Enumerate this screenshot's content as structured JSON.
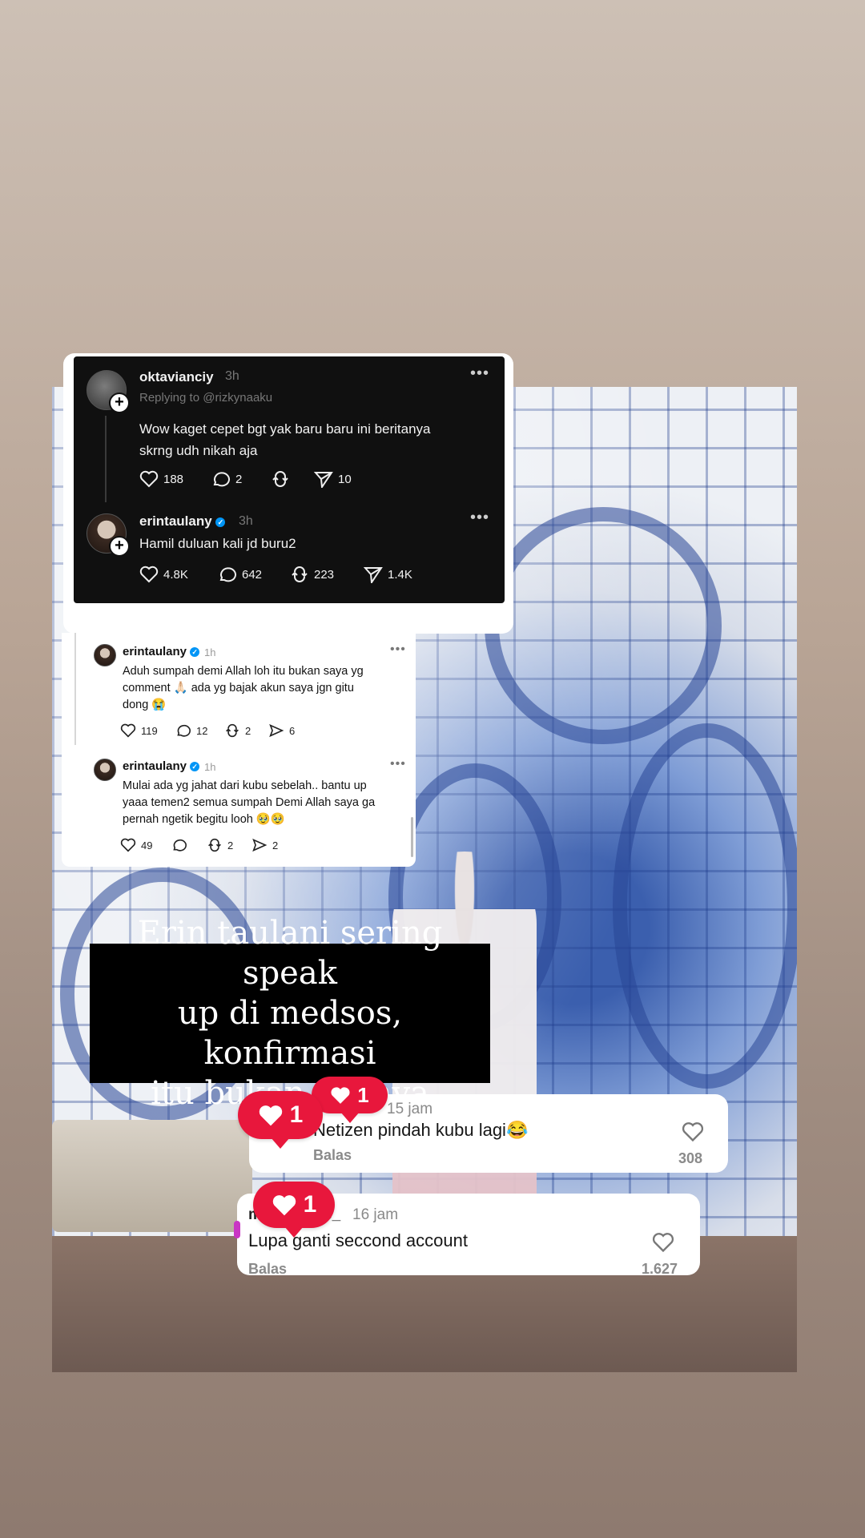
{
  "threads_dark": {
    "post1": {
      "username": "oktavianciy",
      "time": "3h",
      "replying": "Replying to @rizkynaaku",
      "text_line1": "Wow kaget cepet bgt yak baru baru ini beritanya",
      "text_line2": "skrng udh nikah aja",
      "likes": "188",
      "replies": "2",
      "shares": "10"
    },
    "post2": {
      "username": "erintaulany",
      "time": "3h",
      "text": "Hamil duluan kali jd buru2",
      "likes": "4.8K",
      "replies": "642",
      "reposts": "223",
      "shares": "1.4K"
    }
  },
  "threads_white": {
    "post1": {
      "username": "erintaulany",
      "time": "1h",
      "text_line1": "Aduh sumpah demi Allah loh itu bukan saya yg",
      "text_line2": "comment 🙏🏻 ada yg bajak akun saya jgn gitu",
      "text_line3": "dong 😭",
      "likes": "119",
      "replies": "12",
      "reposts": "2",
      "shares": "6"
    },
    "post2": {
      "username": "erintaulany",
      "time": "1h",
      "text_line1": "Mulai ada yg jahat dari kubu sebelah.. bantu up",
      "text_line2": "yaaa temen2 semua sumpah Demi Allah saya ga",
      "text_line3": "pernah ngetik begitu looh 🥹🥹",
      "likes": "49",
      "reposts": "2",
      "shares": "2"
    }
  },
  "caption": {
    "line1": "Erin taulani sering speak",
    "line2": "up di medsos, konfirmasi",
    "line3": "itu bukan dirinya"
  },
  "comments": [
    {
      "user_time": "15 jam",
      "text": "Netizen pindah kubu lagi😂",
      "reply": "Balas",
      "likes": "308"
    },
    {
      "user_prefix": "m",
      "user_suffix": "e_",
      "time": "16 jam",
      "text": "Lupa ganti seccond account",
      "reply": "Balas",
      "likes": "1.627"
    }
  ],
  "like_badges": [
    "1",
    "1",
    "1"
  ],
  "colors": {
    "like_red": "#e8173c",
    "verified_blue": "#0095f6",
    "threads_dark_bg": "#101010"
  }
}
